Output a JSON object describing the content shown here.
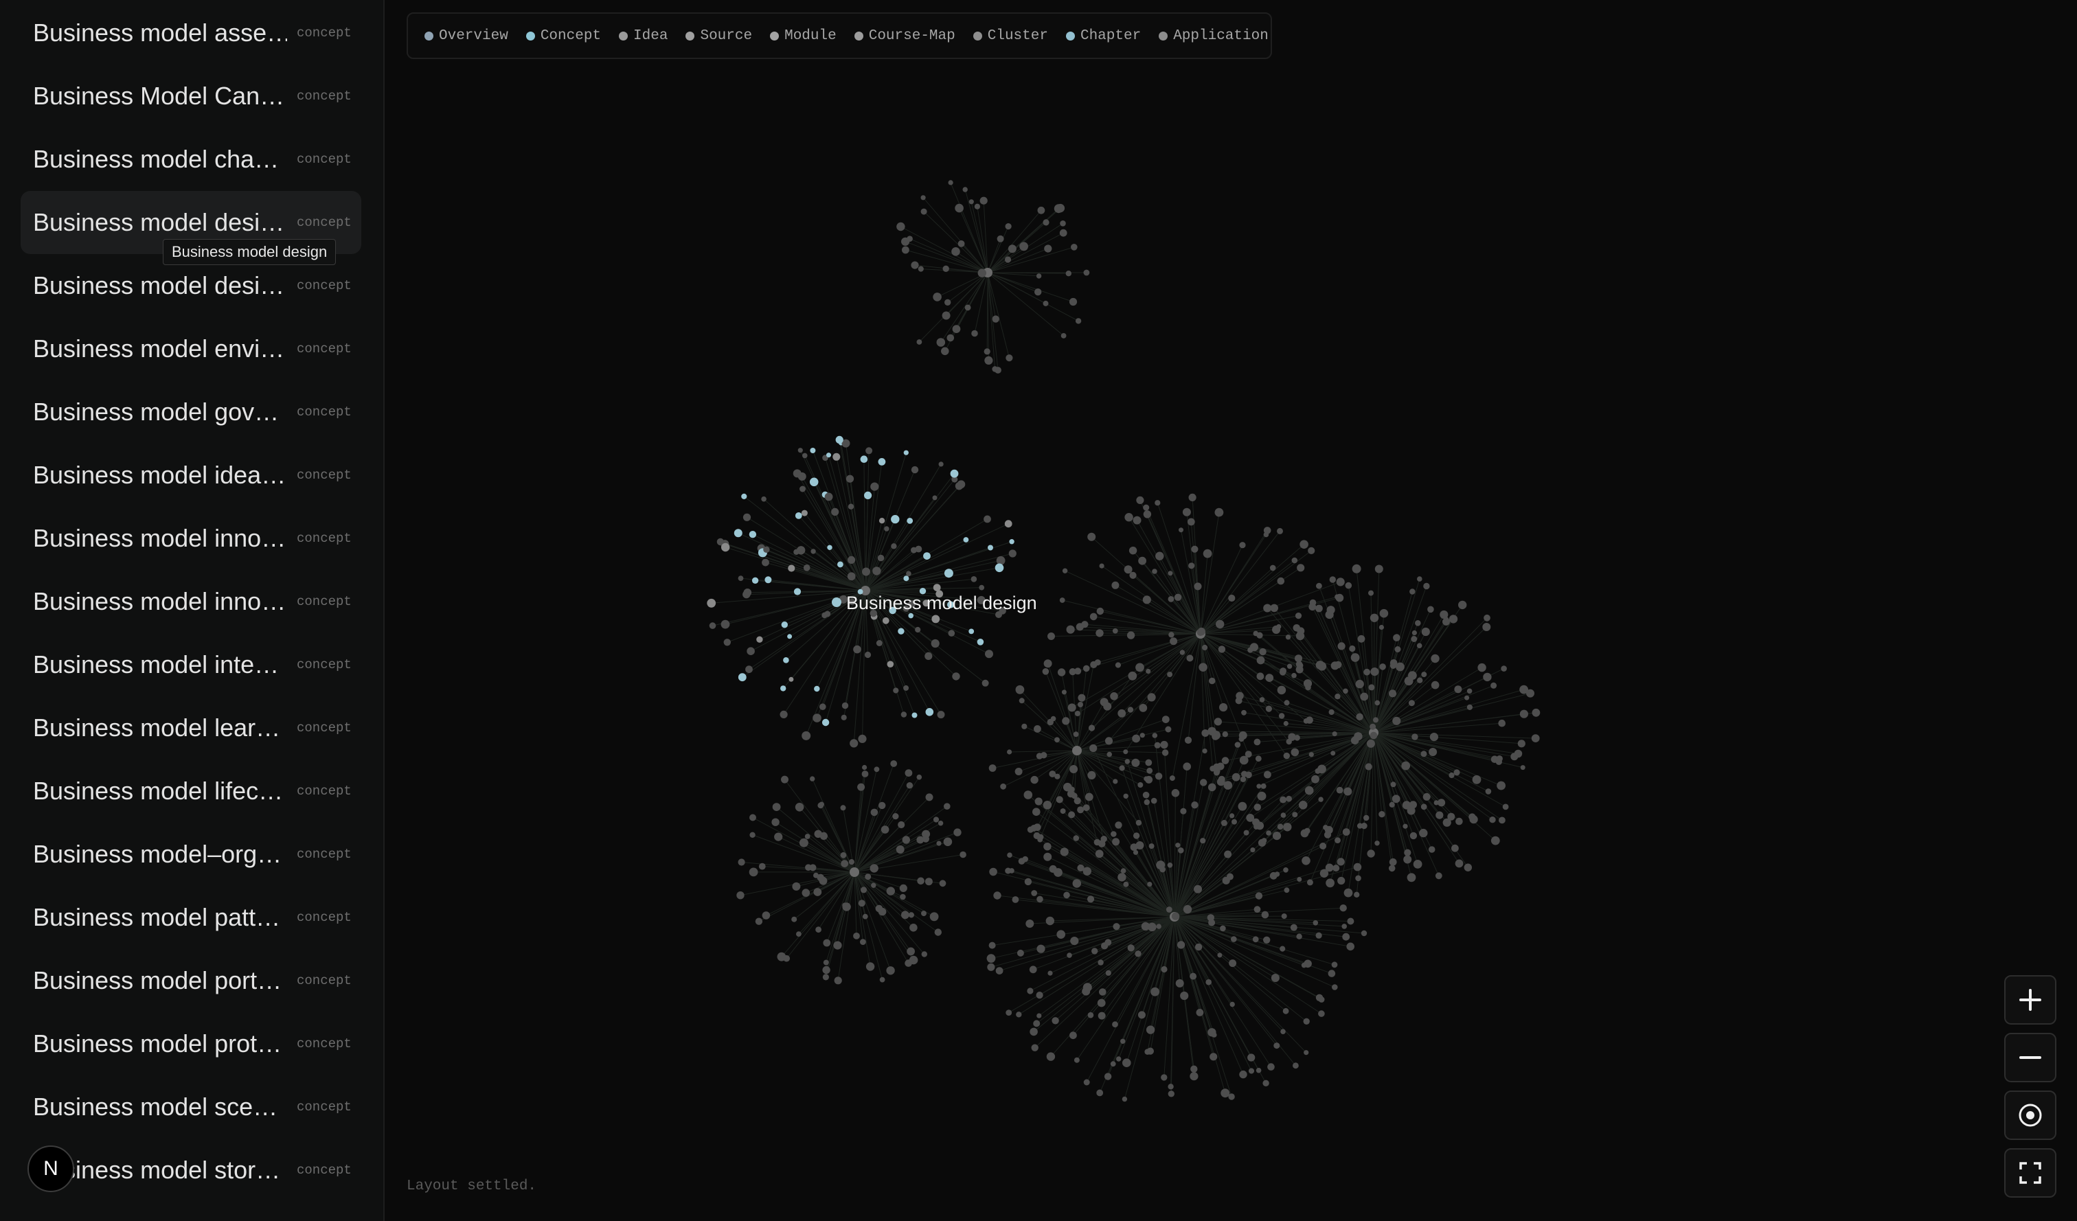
{
  "sidebar": {
    "items": [
      {
        "title": "Business model asse…",
        "type": "concept"
      },
      {
        "title": "Business Model Can…",
        "type": "concept"
      },
      {
        "title": "Business model cha…",
        "type": "concept"
      },
      {
        "title": "Business model desi…",
        "type": "concept",
        "selected": true
      },
      {
        "title": "Business model desi…",
        "type": "concept"
      },
      {
        "title": "Business model envi…",
        "type": "concept"
      },
      {
        "title": "Business model gov…",
        "type": "concept"
      },
      {
        "title": "Business model idea…",
        "type": "concept"
      },
      {
        "title": "Business model inno…",
        "type": "concept"
      },
      {
        "title": "Business model inno…",
        "type": "concept"
      },
      {
        "title": "Business model inte…",
        "type": "concept"
      },
      {
        "title": "Business model lear…",
        "type": "concept"
      },
      {
        "title": "Business model lifec…",
        "type": "concept"
      },
      {
        "title": "Business model–org…",
        "type": "concept"
      },
      {
        "title": "Business model patt…",
        "type": "concept"
      },
      {
        "title": "Business model port…",
        "type": "concept"
      },
      {
        "title": "Business model prot…",
        "type": "concept"
      },
      {
        "title": "Business model sce…",
        "type": "concept"
      },
      {
        "title": "Business model stor…",
        "type": "concept"
      }
    ],
    "tooltip": "Business model design",
    "avatar_letter": "N"
  },
  "legend": [
    {
      "label": "Overview",
      "color": "#8fa3b3"
    },
    {
      "label": "Concept",
      "color": "#8ec6d6"
    },
    {
      "label": "Idea",
      "color": "#9a9a9a"
    },
    {
      "label": "Source",
      "color": "#a0a0a0"
    },
    {
      "label": "Module",
      "color": "#a3a3a3"
    },
    {
      "label": "Course-Map",
      "color": "#9d9d9d"
    },
    {
      "label": "Cluster",
      "color": "#8f8f8f"
    },
    {
      "label": "Chapter",
      "color": "#93c0d0"
    },
    {
      "label": "Application",
      "color": "#8d8d8d"
    }
  ],
  "graph": {
    "highlighted_node_label": "Business model design",
    "colors": {
      "node": "#4e4e4e",
      "highlight": "#9cc7d4",
      "edge": "#1e231f"
    }
  },
  "status_text": "Layout settled.",
  "controls": {
    "zoom_in": "plus-icon",
    "zoom_out": "minus-icon",
    "recenter": "target-icon",
    "fullscreen": "fullscreen-icon"
  }
}
